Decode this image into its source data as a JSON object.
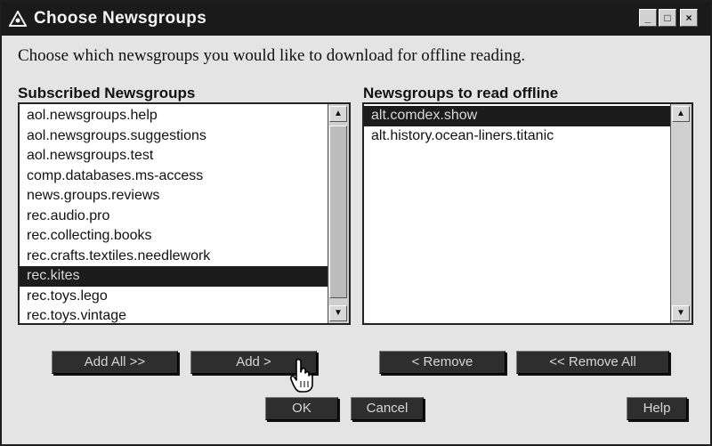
{
  "window": {
    "title": "Choose Newsgroups",
    "minimize_glyph": "_",
    "maximize_glyph": "□",
    "close_glyph": "×"
  },
  "prompt": "Choose which newsgroups you would like to download for offline reading.",
  "subscribed": {
    "label": "Subscribed Newsgroups",
    "items": [
      "aol.newsgroups.help",
      "aol.newsgroups.suggestions",
      "aol.newsgroups.test",
      "comp.databases.ms-access",
      "news.groups.reviews",
      "rec.audio.pro",
      "rec.collecting.books",
      "rec.crafts.textiles.needlework",
      "rec.kites",
      "rec.toys.lego",
      "rec.toys.vintage"
    ],
    "selected_index": 8
  },
  "offline": {
    "label": "Newsgroups to read offline",
    "items": [
      "alt.comdex.show",
      "alt.history.ocean-liners.titanic"
    ],
    "selected_index": 0
  },
  "scroll_glyphs": {
    "up": "▲",
    "down": "▼"
  },
  "buttons": {
    "add_all": "Add All >>",
    "add": "Add >",
    "remove": "< Remove",
    "remove_all": "<< Remove All",
    "ok": "OK",
    "cancel": "Cancel",
    "help": "Help"
  },
  "icons": {
    "app": "aol-triangle-icon",
    "cursor": "hand-pointer-icon"
  }
}
